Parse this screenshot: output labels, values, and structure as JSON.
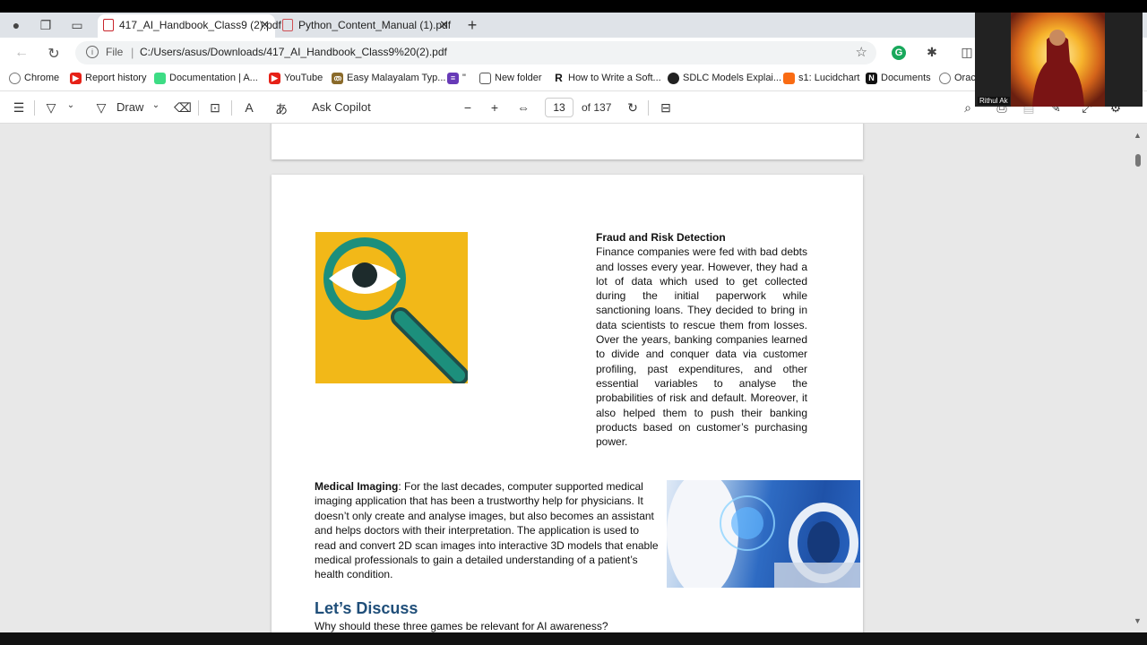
{
  "tabs": [
    {
      "title": "417_AI_Handbook_Class9 (2).pdf",
      "active": true
    },
    {
      "title": "Python_Content_Manual (1).pdf",
      "active": false
    }
  ],
  "address": {
    "scheme_label": "File",
    "url": "C:/Users/asus/Downloads/417_AI_Handbook_Class9%20(2).pdf"
  },
  "bookmarks": [
    {
      "label": "Chrome",
      "icon": "globe-icon"
    },
    {
      "label": "Report history",
      "icon": "youtube-icon"
    },
    {
      "label": "Documentation | A...",
      "icon": "android-icon"
    },
    {
      "label": "YouTube",
      "icon": "youtube-icon"
    },
    {
      "label": "Easy Malayalam Typ...",
      "icon": "keyboard-icon"
    },
    {
      "label": "\"",
      "icon": "form-icon"
    },
    {
      "label": "New folder",
      "icon": "folder-icon"
    },
    {
      "label": "How to Write a Soft...",
      "icon": "r-icon"
    },
    {
      "label": "SDLC Models Explai...",
      "icon": "circle-icon"
    },
    {
      "label": "s1: Lucidchart",
      "icon": "lucidchart-icon"
    },
    {
      "label": "Documents",
      "icon": "notion-icon"
    },
    {
      "label": "Orac",
      "icon": "globe-icon"
    }
  ],
  "toolbar": {
    "draw_label": "Draw",
    "copilot_label": "Ask Copilot",
    "page_number": "13",
    "page_total": "of 137"
  },
  "content": {
    "fraud_heading": "Fraud and Risk Detection",
    "fraud_body": "Finance companies were fed with bad debts and losses every year. However, they had a lot of data which used to get collected during the initial paperwork while sanctioning loans. They decided to bring in data scientists to rescue them from losses. Over the years, banking companies learned to divide and conquer data via customer profiling, past expenditures, and other essential variables to analyse the probabilities of risk and default. Moreover, it also helped them to push their banking products based on customer’s purchasing power.",
    "medical_heading": "Medical Imaging",
    "medical_body": ": For the last decades, computer supported medical imaging application that has been a trustworthy help for physicians. It doesn’t only create and analyse images, but also becomes an assistant and helps doctors with their interpretation. The application is used to read and convert 2D scan images into interactive 3D models that enable medical professionals to gain a detailed understanding of a patient’s health condition.",
    "discuss_title": "Let’s Discuss",
    "discuss_question": "Why should these three games be relevant for AI awareness?"
  },
  "webcam": {
    "name": "Rithul Ak"
  },
  "colors": {
    "image_bg": "#f2b818",
    "lens_ring": "#1c8f7c",
    "heading_blue": "#1f4e79"
  }
}
